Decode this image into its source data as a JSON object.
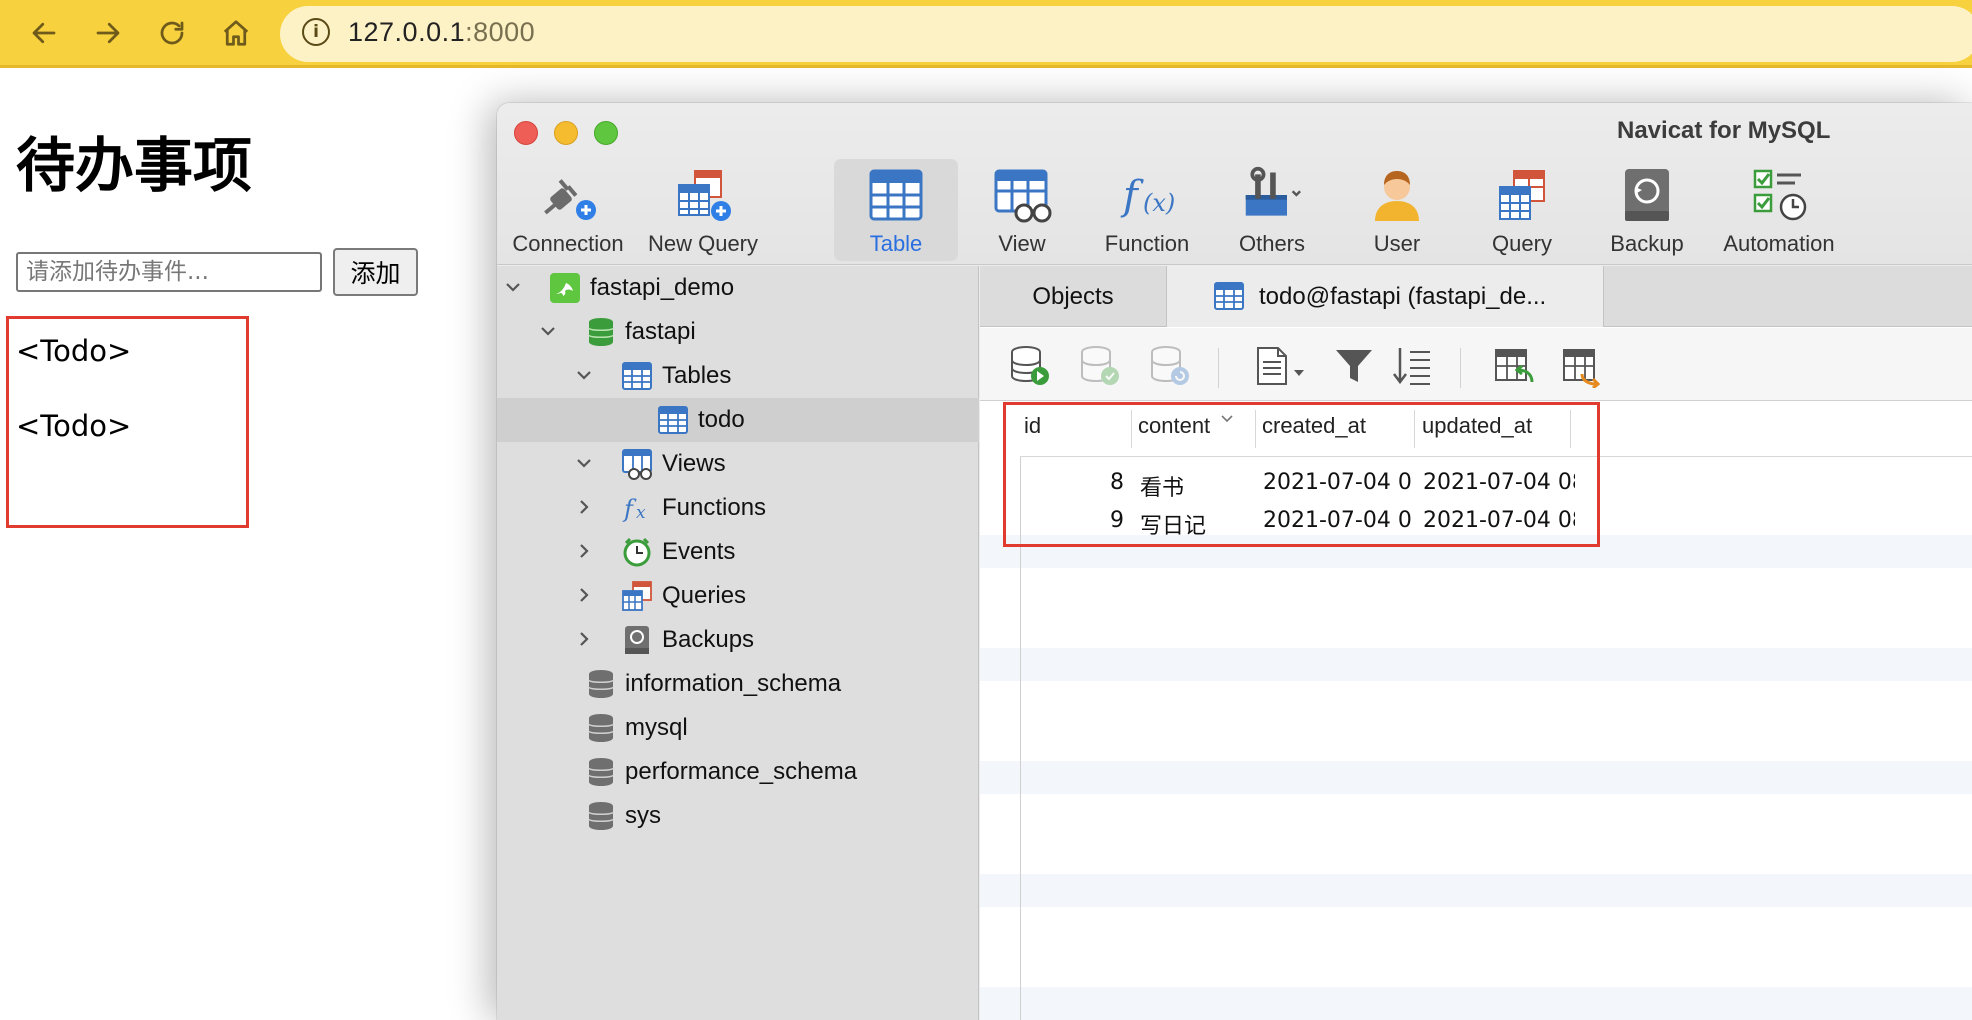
{
  "browser": {
    "url_host": "127.0.0.1",
    "url_port": ":8000",
    "info_icon": "i"
  },
  "todo_page": {
    "title": "待办事项",
    "input_placeholder": "请添加待办事件...",
    "add_button": "添加",
    "items": [
      "<Todo>",
      "<Todo>"
    ]
  },
  "navicat": {
    "window_title": "Navicat for MySQL",
    "toolbar": [
      {
        "label": "Connection",
        "icon": "connection-icon"
      },
      {
        "label": "New Query",
        "icon": "new-query-icon"
      },
      {
        "label": "Table",
        "icon": "table-icon",
        "active": true
      },
      {
        "label": "View",
        "icon": "view-icon"
      },
      {
        "label": "Function",
        "icon": "function-icon"
      },
      {
        "label": "Others",
        "icon": "others-icon"
      },
      {
        "label": "User",
        "icon": "user-icon"
      },
      {
        "label": "Query",
        "icon": "query-icon"
      },
      {
        "label": "Backup",
        "icon": "backup-icon"
      },
      {
        "label": "Automation",
        "icon": "automation-icon"
      }
    ],
    "tree": [
      {
        "label": "fastapi_demo",
        "icon": "connection-dolphin-icon",
        "expanded": true
      },
      {
        "label": "fastapi",
        "icon": "database-green-icon",
        "expanded": true
      },
      {
        "label": "Tables",
        "icon": "tables-icon",
        "expanded": true
      },
      {
        "label": "todo",
        "icon": "table-icon",
        "selected": true
      },
      {
        "label": "Views",
        "icon": "views-icon",
        "expanded": true
      },
      {
        "label": "Functions",
        "icon": "functions-icon",
        "expanded": false
      },
      {
        "label": "Events",
        "icon": "events-icon",
        "expanded": false
      },
      {
        "label": "Queries",
        "icon": "queries-icon",
        "expanded": false
      },
      {
        "label": "Backups",
        "icon": "backups-icon",
        "expanded": false
      },
      {
        "label": "information_schema",
        "icon": "database-gray-icon"
      },
      {
        "label": "mysql",
        "icon": "database-gray-icon"
      },
      {
        "label": "performance_schema",
        "icon": "database-gray-icon"
      },
      {
        "label": "sys",
        "icon": "database-gray-icon"
      }
    ],
    "tabs": {
      "objects": "Objects",
      "active": "todo@fastapi (fastapi_de..."
    },
    "grid": {
      "columns": [
        "id",
        "content",
        "created_at",
        "updated_at"
      ],
      "rows": [
        {
          "id": "8",
          "content": "看书",
          "created_at": "2021-07-04 0",
          "updated_at": "2021-07-04 08"
        },
        {
          "id": "9",
          "content": "写日记",
          "created_at": "2021-07-04 0",
          "updated_at": "2021-07-04 08"
        }
      ]
    }
  },
  "colors": {
    "browser_bar": "#f8d23e",
    "highlight_red": "#e13a2f",
    "active_blue": "#2a6fe0"
  }
}
